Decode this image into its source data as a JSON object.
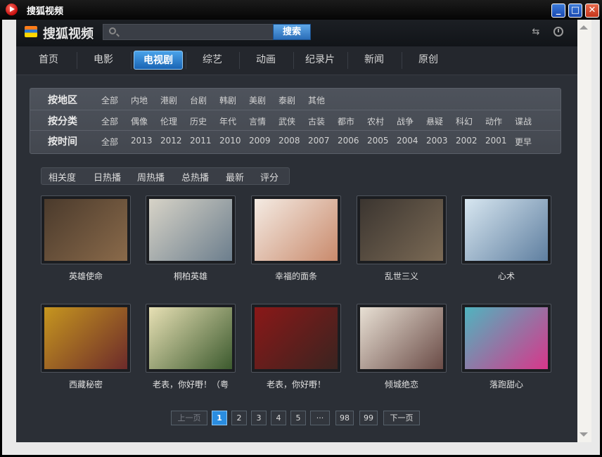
{
  "window": {
    "title": "搜狐视频"
  },
  "header": {
    "logo_text": "搜狐视频",
    "search_placeholder": "",
    "search_button": "搜索"
  },
  "nav": {
    "items": [
      "首页",
      "电影",
      "电视剧",
      "综艺",
      "动画",
      "纪录片",
      "新闻",
      "原创"
    ],
    "active_index": 2
  },
  "filters": {
    "region": {
      "label": "按地区",
      "options": [
        "全部",
        "内地",
        "港剧",
        "台剧",
        "韩剧",
        "美剧",
        "泰剧",
        "其他"
      ]
    },
    "category": {
      "label": "按分类",
      "options": [
        "全部",
        "偶像",
        "伦理",
        "历史",
        "年代",
        "言情",
        "武侠",
        "古装",
        "都市",
        "农村",
        "战争",
        "悬疑",
        "科幻",
        "动作",
        "谍战"
      ]
    },
    "time": {
      "label": "按时间",
      "options": [
        "全部",
        "2013",
        "2012",
        "2011",
        "2010",
        "2009",
        "2008",
        "2007",
        "2006",
        "2005",
        "2004",
        "2003",
        "2002",
        "2001",
        "更早"
      ]
    }
  },
  "sort": {
    "options": [
      "相关度",
      "日热播",
      "周热播",
      "总热播",
      "最新",
      "评分"
    ]
  },
  "shows": [
    {
      "title": "英雄使命",
      "colors": [
        "#4a3a2c",
        "#8a6a4a"
      ]
    },
    {
      "title": "桐柏英雄",
      "colors": [
        "#d7d3c7",
        "#6c7e8d"
      ]
    },
    {
      "title": "幸福的面条",
      "colors": [
        "#f4ebe3",
        "#c98a6c"
      ]
    },
    {
      "title": "乱世三义",
      "colors": [
        "#3b3530",
        "#7b6a55"
      ]
    },
    {
      "title": "心术",
      "colors": [
        "#d7e6f0",
        "#5f7fa0"
      ]
    },
    {
      "title": "西藏秘密",
      "colors": [
        "#c6961f",
        "#6c2a2a"
      ]
    },
    {
      "title": "老表，你好嘢！（粤",
      "colors": [
        "#e7e0b4",
        "#3c5a2e"
      ]
    },
    {
      "title": "老表，你好嘢！",
      "colors": [
        "#8a1818",
        "#3a2420"
      ]
    },
    {
      "title": "倾城绝恋",
      "colors": [
        "#e8e0d4",
        "#6a4b46"
      ]
    },
    {
      "title": "落跑甜心",
      "colors": [
        "#4fb4bf",
        "#d8368a"
      ]
    }
  ],
  "pagination": {
    "prev": "上一页",
    "pages": [
      "1",
      "2",
      "3",
      "4",
      "5",
      "···",
      "98",
      "99"
    ],
    "current": "1",
    "next": "下一页"
  },
  "window_controls": {
    "minimize": "_",
    "maximize": "□",
    "close": "✕"
  }
}
